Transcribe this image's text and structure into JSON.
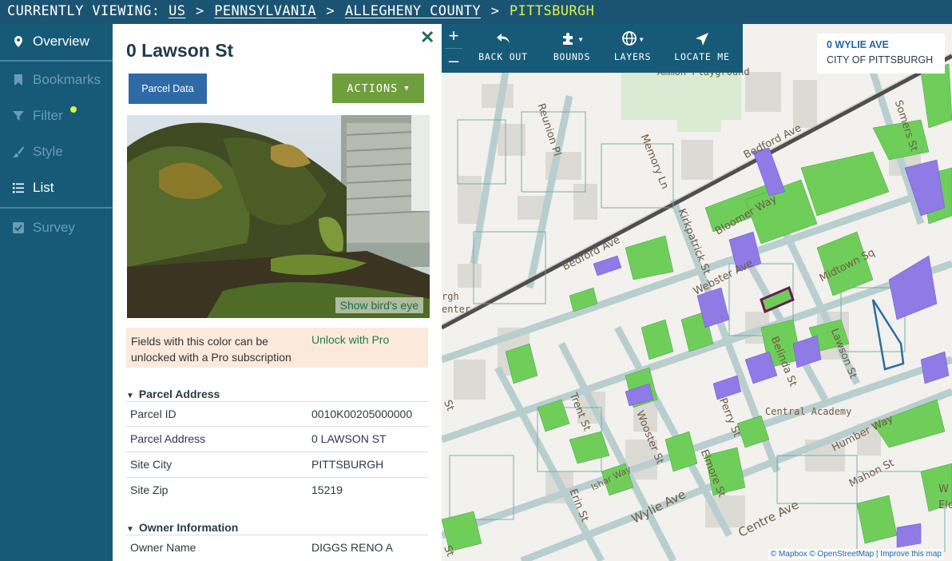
{
  "breadcrumb": {
    "prefix": "CURRENTLY VIEWING:",
    "items": [
      "US",
      "PENNSYLVANIA",
      "ALLEGHENY COUNTY"
    ],
    "current": "PITTSBURGH",
    "separator": ">"
  },
  "sidebar": {
    "items": [
      {
        "label": "Overview",
        "icon": "map-pin-icon",
        "state": "active"
      },
      {
        "label": "Bookmarks",
        "icon": "bookmark-icon",
        "state": "dim"
      },
      {
        "label": "Filter",
        "icon": "filter-icon",
        "state": "dim",
        "badge_color": "#d7f34a"
      },
      {
        "label": "Style",
        "icon": "paintbrush-icon",
        "state": "dim"
      },
      {
        "label": "List",
        "icon": "list-icon",
        "state": "active"
      },
      {
        "label": "Survey",
        "icon": "checkbox-icon",
        "state": "dim"
      }
    ]
  },
  "panel": {
    "title": "0 Lawson St",
    "close_icon": "close-icon",
    "parcel_data_button": "Parcel Data",
    "actions_button": "ACTIONS",
    "photo": {
      "birds_eye_link": "Show bird's eye"
    },
    "pro_notice": {
      "text": "Fields with this color can be unlocked with a Pro subscription",
      "link": "Unlock with Pro",
      "color": "#fbeadb"
    },
    "sections": [
      {
        "title": "Parcel Address",
        "rows": [
          {
            "label": "Parcel ID",
            "value": "0010K00205000000"
          },
          {
            "label": "Parcel Address",
            "value": "0 LAWSON ST"
          },
          {
            "label": "Site City",
            "value": "PITTSBURGH"
          },
          {
            "label": "Site Zip",
            "value": "15219"
          }
        ]
      },
      {
        "title": "Owner Information",
        "rows": [
          {
            "label": "Owner Name",
            "value": "DIGGS RENO A"
          }
        ]
      }
    ]
  },
  "map": {
    "zoom_in": "+",
    "zoom_out": "–",
    "tools": [
      {
        "label": "BACK OUT",
        "icon": "undo-arrow-icon"
      },
      {
        "label": "BOUNDS",
        "icon": "puzzle-icon"
      },
      {
        "label": "LAYERS",
        "icon": "globe-icon"
      },
      {
        "label": "LOCATE ME",
        "icon": "location-arrow-icon"
      }
    ],
    "location": {
      "street": "0 WYLIE AVE",
      "city": "CITY OF PITTSBURGH"
    },
    "attribution": "© Mapbox © OpenStreetMap | Improve this map",
    "street_labels": [
      "Bedford Ave",
      "Bedford Ave",
      "Somers St",
      "Reunion Pl",
      "Memory Ln",
      "Bloomer Way",
      "Kirkpatrick St",
      "Webster Ave",
      "Midtown Sq",
      "Belinda St",
      "Lawson St",
      "Central Academy",
      "Trent St",
      "Wooster St",
      "Perry St",
      "Elmore St",
      "Humber Way",
      "Mahon St",
      "Erin St",
      "Wylie Ave",
      "Centre Ave",
      "Ishar Way",
      "Ammon Playground",
      "rgh",
      "enter",
      "W",
      "Ele",
      "St",
      "St"
    ],
    "colors": {
      "vacant": "#6fce5a",
      "other": "#8f7ae6",
      "selected_outline": "#6a1b4d",
      "outline": "#2a6fa1"
    }
  }
}
